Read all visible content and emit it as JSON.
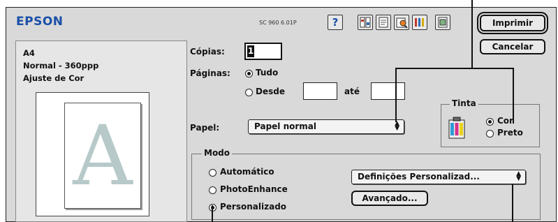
{
  "header": {
    "logo": "EPSON",
    "model": "SC 960 6.01P",
    "help_label": "?",
    "print_button": "Imprimir",
    "cancel_button": "Cancelar"
  },
  "summary": {
    "paper_size": "A4",
    "quality": "Normal - 360ppp",
    "color_adjust": "Ajuste de Cor",
    "preview_letter": "A"
  },
  "copies": {
    "label": "Cópias:",
    "value": "1"
  },
  "pages": {
    "label": "Páginas:",
    "options": [
      {
        "label": "Tudo",
        "selected": true
      },
      {
        "label": "Desde",
        "selected": false
      }
    ],
    "from_value": "",
    "to_label": "até",
    "to_value": ""
  },
  "paper": {
    "label": "Papel:",
    "value": "Papel normal"
  },
  "ink": {
    "title": "Tinta",
    "options": [
      {
        "label": "Cor",
        "selected": true
      },
      {
        "label": "Preto",
        "selected": false
      }
    ]
  },
  "mode": {
    "title": "Modo",
    "options": [
      {
        "label": "Automático",
        "selected": false
      },
      {
        "label": "PhotoEnhance",
        "selected": false
      },
      {
        "label": "Personalizado",
        "selected": true
      }
    ],
    "custom_select": "Definições Personalizad...",
    "advanced_button": "Avançado..."
  },
  "icons": [
    "help-icon",
    "layout-icon",
    "page-setup-icon",
    "preview-icon",
    "utility-icon",
    "background-print-icon",
    "ink-cartridge-icon"
  ],
  "colors": {
    "logo": "#1a4fa8",
    "dialog_bg": "#d9d9d9",
    "preview_letter": "#b7c9c9"
  }
}
